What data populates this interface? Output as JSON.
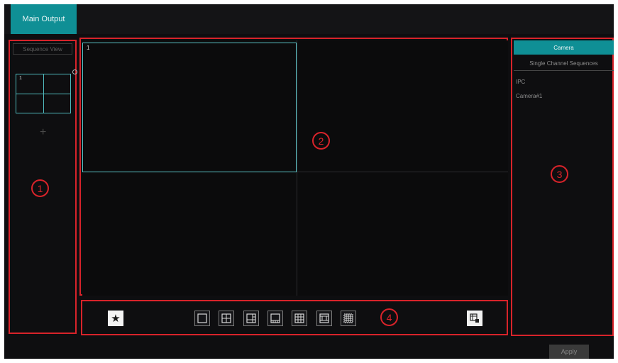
{
  "tabs": [
    "Main Output"
  ],
  "left_panel": {
    "header": "Sequence View",
    "tile_label": "1",
    "add_symbol": "+"
  },
  "video_area": {
    "cell_label": "1"
  },
  "right_panel": {
    "tabs": [
      "Camera",
      "Single Channel Sequences"
    ],
    "items": [
      "IPC",
      "Camera#1"
    ]
  },
  "annotations": [
    "1",
    "2",
    "3",
    "4"
  ],
  "toolbar": {
    "favorite_icon": "star-icon",
    "layout_icons": [
      "layout-1-icon",
      "layout-4-icon",
      "layout-6-icon",
      "layout-8-icon",
      "layout-9-icon",
      "layout-13-icon",
      "layout-16-icon"
    ],
    "delete_icon": "delete-layout-icon"
  },
  "footer": {
    "apply_label": "Apply"
  },
  "colors": {
    "accent": "#0f8f95",
    "annotation": "#d8232a",
    "background": "#0e0e10"
  }
}
